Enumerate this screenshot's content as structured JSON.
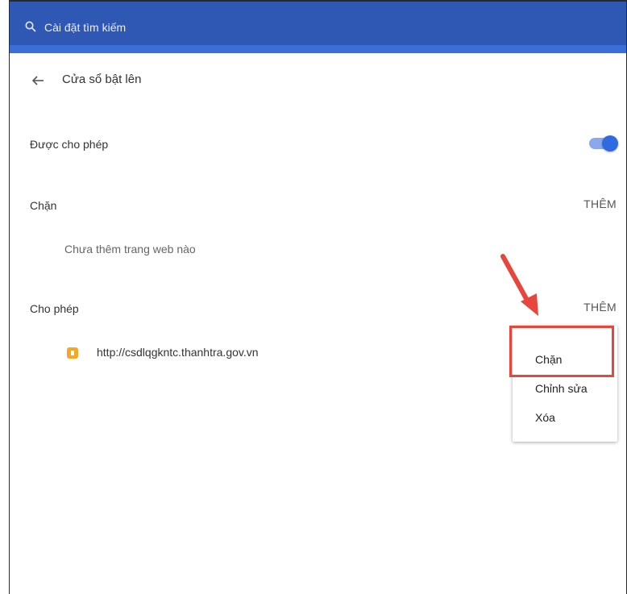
{
  "header": {
    "search_placeholder": "Cài đặt tìm kiếm"
  },
  "page": {
    "title": "Cửa sổ bật lên"
  },
  "allowed_toggle": {
    "label": "Được cho phép",
    "on": true
  },
  "block_section": {
    "label": "Chặn",
    "add_label": "THÊM",
    "empty_text": "Chưa thêm trang web nào"
  },
  "allow_section": {
    "label": "Cho phép",
    "add_label": "THÊM",
    "sites": [
      {
        "url": "http://csdlqgkntc.thanhtra.gov.vn"
      }
    ]
  },
  "context_menu": {
    "items": [
      {
        "label": "Chặn",
        "highlighted": true
      },
      {
        "label": "Chỉnh sửa"
      },
      {
        "label": "Xóa"
      }
    ]
  },
  "colors": {
    "header_bg": "#2f58b5",
    "toggle_on": "#2f6ae0",
    "annotation_red": "#e8453c",
    "favicon": "#f5a623"
  },
  "icons": {
    "search": "search-icon",
    "back": "arrow-left-icon",
    "favicon": "site-favicon-icon",
    "annotation": "red-arrow-icon"
  }
}
